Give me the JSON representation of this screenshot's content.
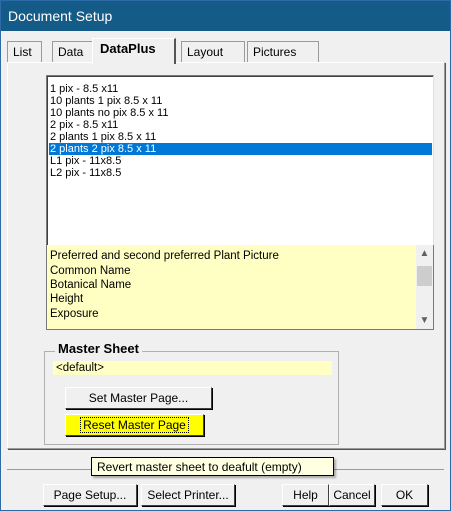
{
  "window": {
    "title": "Document Setup"
  },
  "tabs": [
    {
      "label": "List"
    },
    {
      "label": "Data"
    },
    {
      "label": "DataPlus"
    },
    {
      "label": "Layout"
    },
    {
      "label": "Pictures"
    }
  ],
  "layout_list": {
    "items": [
      "1 pix - 8.5 x11",
      "10 plants 1 pix 8.5 x 11",
      "10 plants no pix 8.5 x 11",
      "2 pix - 8.5 x11",
      "2 plants 1 pix 8.5 x 11",
      "2 plants 2 pix 8.5 x 11",
      "L1 pix - 11x8.5",
      "L2 pix - 11x8.5"
    ],
    "selected": "2 plants 2 pix 8.5 x 11"
  },
  "fields_list": {
    "items": [
      "Preferred and second preferred Plant Picture",
      "Common Name",
      "Botanical Name",
      "Height",
      "Exposure"
    ]
  },
  "master_sheet": {
    "label": "Master Sheet",
    "value": "<default>",
    "set_button": "Set Master Page...",
    "reset_button": "Reset Master Page"
  },
  "tooltip": "Revert master sheet to deafult (empty)",
  "footer": {
    "page_setup": "Page Setup...",
    "select_printer": "Select Printer...",
    "help": "Help",
    "cancel": "Cancel",
    "ok": "OK"
  },
  "colors": {
    "titlebar": "#155b87",
    "selection": "#0078d7",
    "field_bg": "#ffffc4",
    "highlight_button": "#ffff00"
  }
}
